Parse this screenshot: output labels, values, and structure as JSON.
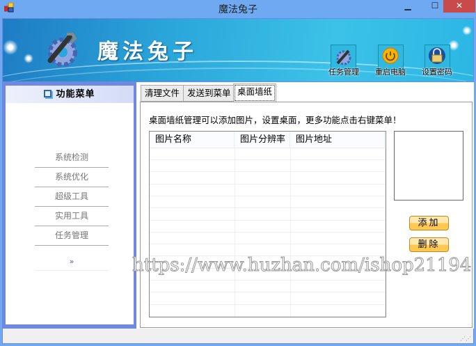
{
  "window": {
    "title": "魔法兔子",
    "minimize": "▁",
    "maximize": "☐",
    "close": "✕"
  },
  "banner": {
    "app_name": "魔法兔子",
    "buttons": [
      {
        "label": "任务管理",
        "icon": "gear-wrench-icon"
      },
      {
        "label": "重启电脑",
        "icon": "power-icon"
      },
      {
        "label": "设置密码",
        "icon": "lock-icon"
      }
    ]
  },
  "sidebar": {
    "title": "功能菜单",
    "items": [
      "系统检测",
      "系统优化",
      "超级工具",
      "实用工具",
      "任务管理"
    ],
    "more": "»"
  },
  "tabs": [
    {
      "label": "清理文件"
    },
    {
      "label": "发送到菜单"
    },
    {
      "label": "桌面墙纸",
      "active": true
    }
  ],
  "wallpaper": {
    "description": "桌面墙纸管理可以添加图片，设置桌面，更多功能点击右键菜单！",
    "columns": [
      "图片名称",
      "图片分辨率",
      "图片地址"
    ],
    "rows": [],
    "add_button": "添加",
    "delete_button": "删除"
  },
  "watermark": "https://www.huzhan.com/ishop21194",
  "colors": {
    "titlebar": "#6ea9f2",
    "close": "#c94a4a",
    "sidebar_frame": "#7088e0",
    "button": "#ffc850"
  }
}
